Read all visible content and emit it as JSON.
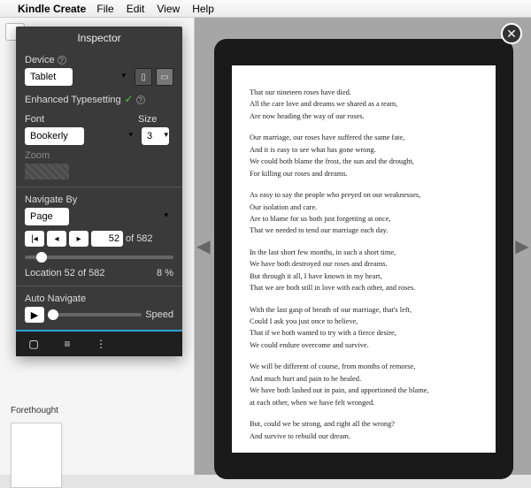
{
  "menubar": {
    "app": "Kindle Create",
    "items": [
      "File",
      "Edit",
      "View",
      "Help"
    ]
  },
  "inspector": {
    "title": "Inspector",
    "device_label": "Device",
    "device_value": "Tablet",
    "typesetting_label": "Enhanced Typesetting",
    "font_label": "Font",
    "size_label": "Size",
    "font_value": "Bookerly",
    "size_value": "3",
    "zoom_label": "Zoom",
    "navigate_label": "Navigate By",
    "navigate_value": "Page",
    "page_current": "52",
    "page_total": "582",
    "of": "of",
    "location_text": "Location 52 of 582",
    "percent": "8 %",
    "auto_navigate_label": "Auto Navigate",
    "speed_label": "Speed"
  },
  "left": {
    "thumb_label": "Forethought"
  },
  "content": {
    "stanzas": [
      [
        "That our nineteen roses have died.",
        "All the care love and dreams we shared as a team,",
        "Are now heading the way of our roses."
      ],
      [
        "Our marriage, our roses have suffered the same fate,",
        "And it is easy to see what has gone wrong.",
        "We could both blame the frost, the sun and the drought,",
        "For killing our roses and dreams."
      ],
      [
        "As easy to say the people who preyed on our weaknesses,",
        "Our isolation and care.",
        "Are to blame for us both just forgetting at once,",
        "That we needed to tend our marriage each day."
      ],
      [
        "In the last short few months, in such a short time,",
        "We have both destroyed our roses and dreams.",
        "But through it all, I have known in my heart,",
        "That we are both still in love with each other, and roses."
      ],
      [
        "With the last gasp of breath of our marriage, that's left,",
        "Could I ask you just once to believe,",
        "That if we both wanted to try with a fierce desire,",
        "We could endure overcome and survive."
      ],
      [
        "We will be different of course, from months of remorse,",
        "And much hurt and pain to be healed.",
        "We have both lashed out in pain, and apportioned the blame,",
        "at each other, when we have felt wronged."
      ],
      [
        "But, could we be strong, and right all the wrong?",
        "And survive to rebuild our dream."
      ]
    ]
  }
}
